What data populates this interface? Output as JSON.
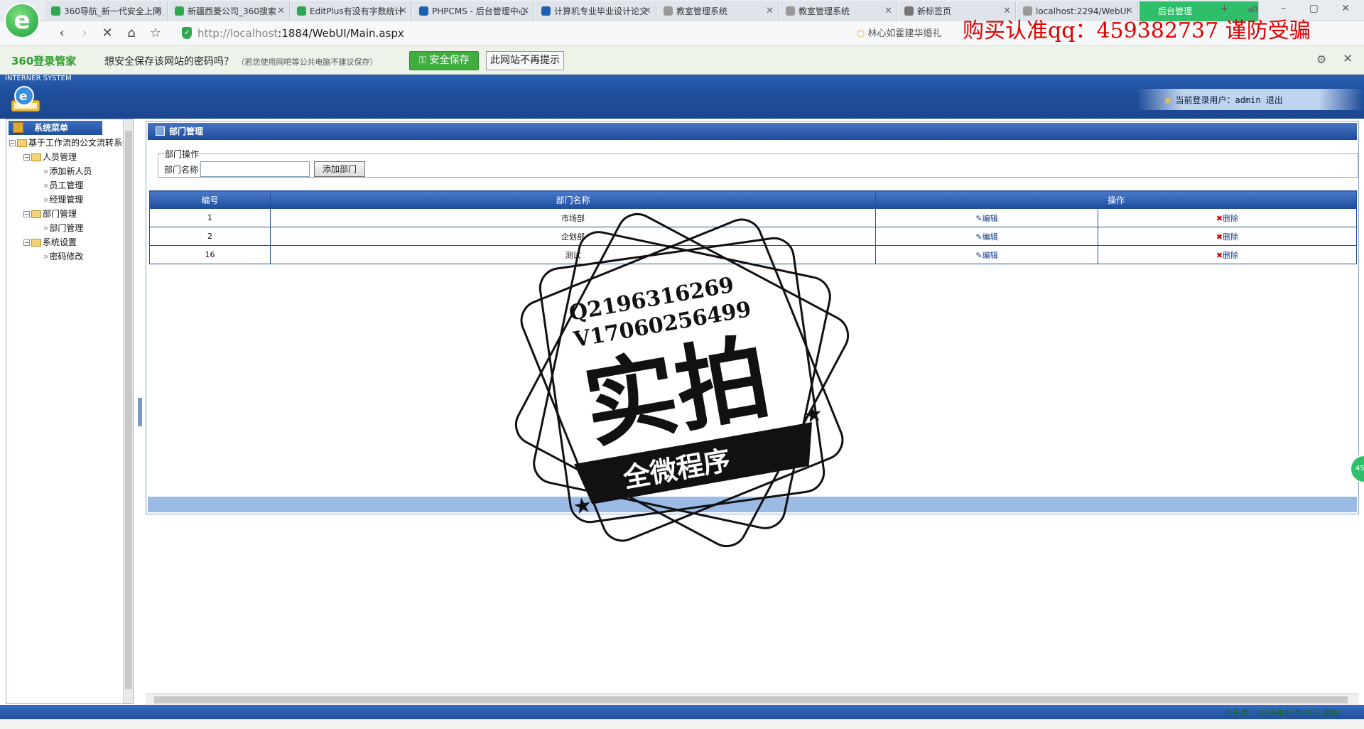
{
  "browser": {
    "tabs": [
      {
        "label": "360导航_新一代安全上网",
        "icon_color": "#2fa84f"
      },
      {
        "label": "新疆西菱公司_360搜索",
        "icon_color": "#2fa84f"
      },
      {
        "label": "EditPlus有没有字数统计",
        "icon_color": "#2fa84f"
      },
      {
        "label": "PHPCMS - 后台管理中心",
        "icon_color": "#1f5fb0"
      },
      {
        "label": "计算机专业毕业设计论文",
        "icon_color": "#1f5fb0"
      },
      {
        "label": "教室管理系统",
        "icon_color": "#999999"
      },
      {
        "label": "教室管理系统",
        "icon_color": "#999999"
      },
      {
        "label": "新标签页",
        "icon_color": "#777777"
      },
      {
        "label": "localhost:2294/WebUI",
        "icon_color": "#999999"
      },
      {
        "label": "后台管理",
        "icon_color": "#ffffff"
      }
    ],
    "url_host": "http://localhost",
    "url_path": ":1884/WebUI/Main.aspx",
    "search_text": "林心如霍建华婚礼",
    "scam_banner": "购买认准qq：459382737 谨防受骗"
  },
  "pwbar": {
    "brand": "360登录管家",
    "message": "想安全保存该网站的密码吗？",
    "note": "（若您使用网吧等公共电脑不建议保存）",
    "save_label": "安全保存",
    "never_label": "此网站不再提示"
  },
  "app": {
    "system_name": "INTERNER SYSTEM",
    "user_prefix": "当前登录用户：",
    "user_name": "admin",
    "logout_label": "退出"
  },
  "sidebar": {
    "title": "系统菜单",
    "root": "基于工作流的公文流转系统",
    "groups": [
      {
        "label": "人员管理",
        "items": [
          "添加新人员",
          "员工管理",
          "经理管理"
        ]
      },
      {
        "label": "部门管理",
        "items": [
          "部门管理"
        ]
      },
      {
        "label": "系统设置",
        "items": [
          "密码修改"
        ]
      }
    ]
  },
  "main": {
    "panel_title": "部门管理",
    "fieldset_legend": "部门操作",
    "name_label": "部门名称",
    "name_value": "",
    "add_label": "添加部门",
    "columns": [
      "编号",
      "部门名称",
      "操作"
    ],
    "edit_label": "编辑",
    "delete_label": "删除",
    "rows": [
      {
        "id": "1",
        "name": "市场部"
      },
      {
        "id": "2",
        "name": "企划部"
      },
      {
        "id": "16",
        "name": "测试"
      }
    ]
  },
  "status": {
    "date_text": "今天是：2016年07月05日 星期二"
  },
  "stamp": {
    "qq": "Q2196316269",
    "wx": "V17060256499",
    "big": "实拍",
    "ribbon": "全微程序"
  },
  "badge": {
    "text": "45"
  }
}
